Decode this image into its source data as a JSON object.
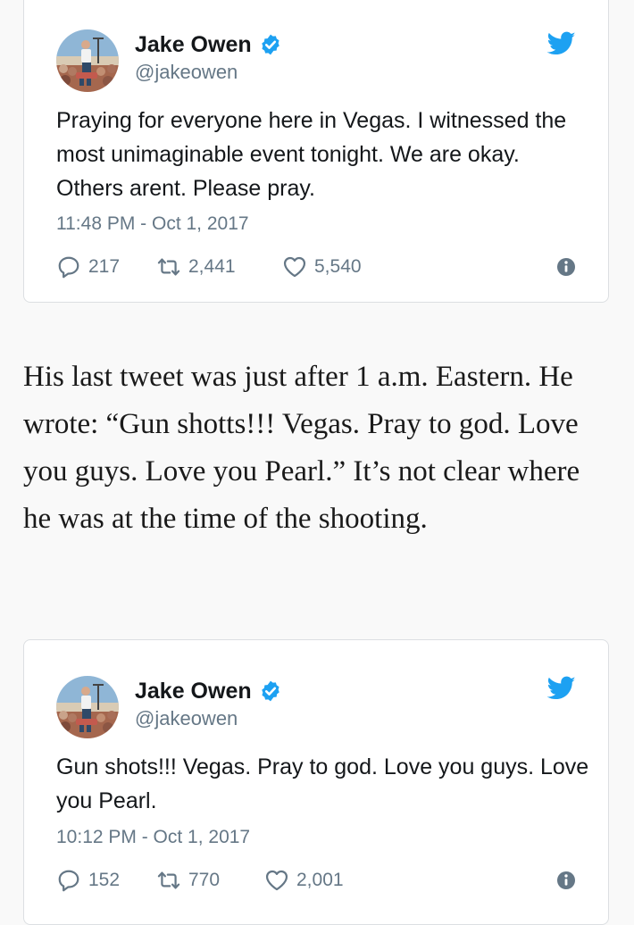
{
  "tweets": [
    {
      "name": "Jake Owen",
      "handle": "@jakeowen",
      "text": "Praying for everyone here in Vegas. I witnessed the most unimaginable event tonight. We are okay. Others arent. Please pray.",
      "timestamp": "11:48 PM - Oct 1, 2017",
      "replies": "217",
      "retweets": "2,441",
      "likes": "5,540"
    },
    {
      "name": "Jake Owen",
      "handle": "@jakeowen",
      "text": "Gun shots!!! Vegas. Pray to god. Love you guys. Love you Pearl.",
      "timestamp": "10:12 PM - Oct 1, 2017",
      "replies": "152",
      "retweets": "770",
      "likes": "2,001"
    }
  ],
  "article": {
    "paragraph": "His last tweet was just after 1 a.m. Eastern. He wrote: “Gun shotts!!! Vegas. Pray to god. Love you guys. Love you Pearl.” It’s not clear where he was at the time of the shooting."
  },
  "icons": {
    "verified": "verified-badge-icon",
    "brand": "twitter-bird-icon",
    "reply": "reply-icon",
    "retweet": "retweet-icon",
    "like": "heart-icon",
    "info": "info-icon"
  },
  "colors": {
    "twitter_blue": "#1da1f2",
    "muted_text": "#657786",
    "page_background": "#f9f9f9"
  }
}
